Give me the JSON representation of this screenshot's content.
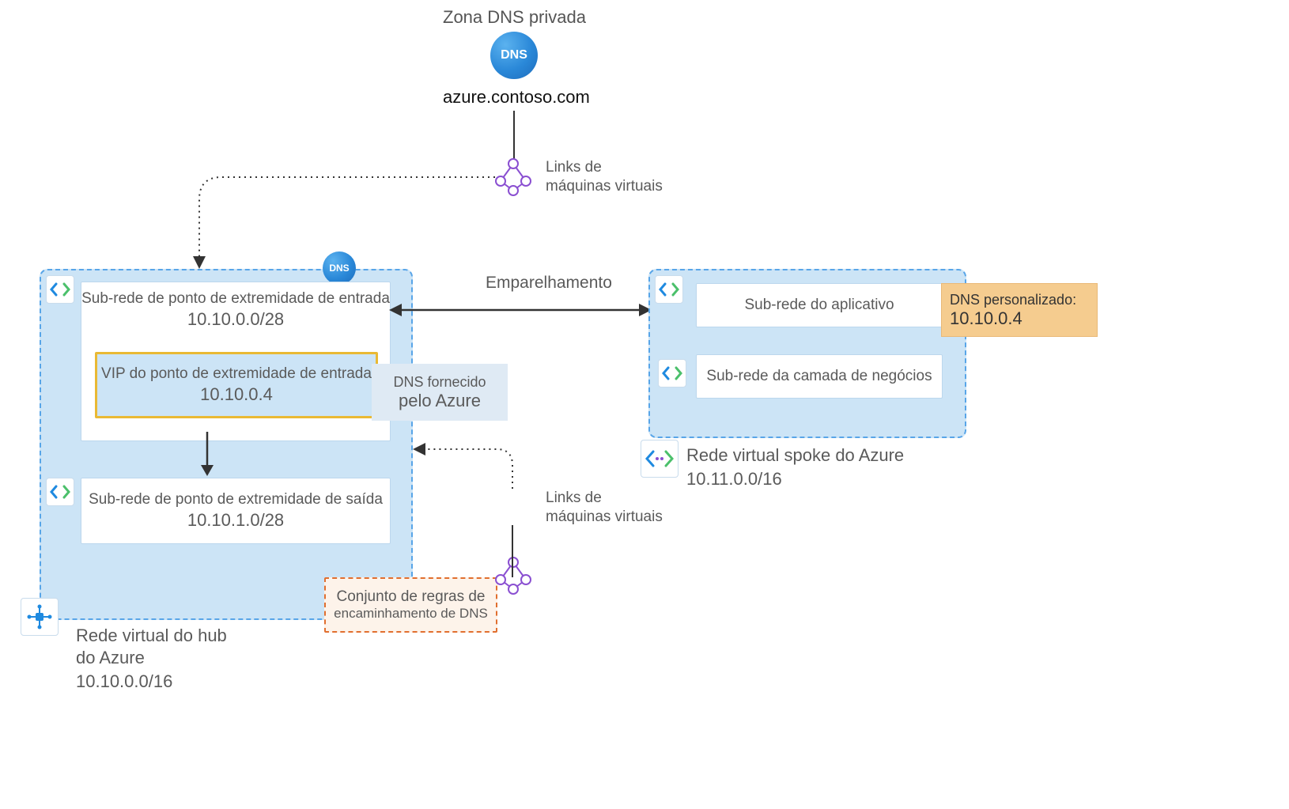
{
  "private_zone": {
    "title": "Zona DNS privada",
    "icon_text": "DNS",
    "domain": "azure.contoso.com"
  },
  "vm_links_top": {
    "line1": "Links de",
    "line2": "máquinas virtuais"
  },
  "vm_links_mid": {
    "line1": "Links de",
    "line2": "máquinas virtuais"
  },
  "peering_label": "Emparelhamento",
  "hub": {
    "title_line1": "Rede virtual do hub",
    "title_line2": "do Azure",
    "cidr": "10.10.0.0/16",
    "dns_badge_text": "DNS",
    "inbound_subnet": {
      "label": "Sub-rede de ponto de extremidade de entrada",
      "cidr": "10.10.0.0/28"
    },
    "inbound_vip": {
      "label": "VIP do ponto de extremidade de entrada",
      "ip": "10.10.0.4"
    },
    "outbound_subnet": {
      "label": "Sub-rede de ponto de extremidade de saída",
      "cidr": "10.10.1.0/28"
    },
    "azure_dns": {
      "line1": "DNS fornecido",
      "line2": "pelo Azure"
    },
    "ruleset": {
      "line1": "Conjunto de regras de",
      "line2": "encaminhamento de DNS"
    }
  },
  "spoke": {
    "title": "Rede virtual spoke do Azure",
    "cidr": "10.11.0.0/16",
    "app_subnet": "Sub-rede do aplicativo",
    "biz_subnet": "Sub-rede da camada de negócios",
    "custom_dns": {
      "label": "DNS personalizado:",
      "ip": "10.10.0.4"
    }
  }
}
